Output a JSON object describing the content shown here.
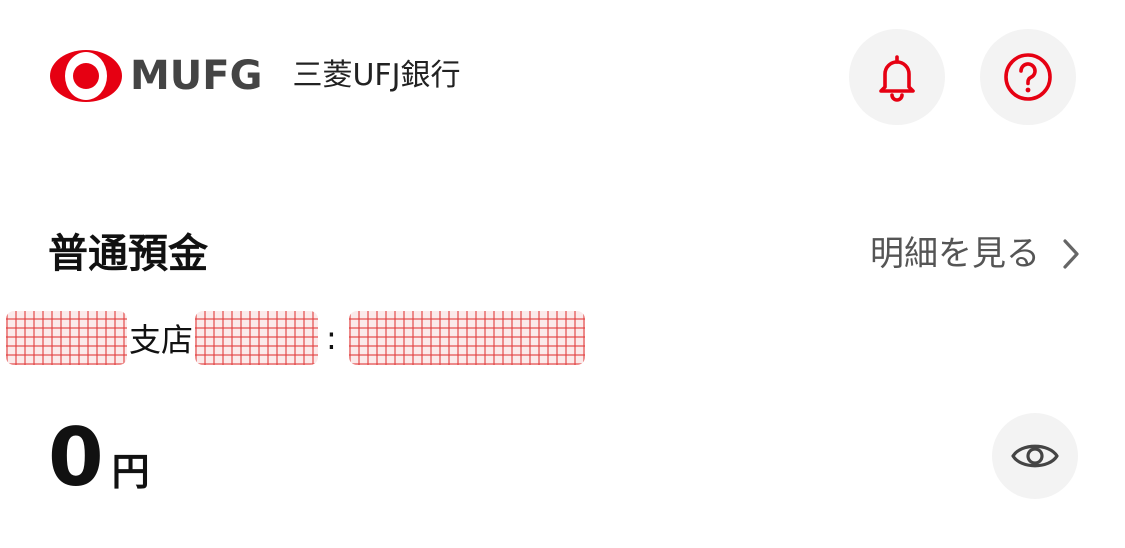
{
  "header": {
    "brand": "MUFG",
    "bank_name": "三菱UFJ銀行",
    "logo_icon": "mufg-logo-icon",
    "notification_icon": "bell-icon",
    "help_icon": "help-question-icon",
    "accent_color": "#e60012"
  },
  "account": {
    "title": "普通預金",
    "details_link": "明細を見る",
    "details_icon": "chevron-right-icon",
    "branch_label": "支店",
    "separator": ":",
    "balance_amount": "0",
    "balance_unit": "円",
    "toggle_visibility_icon": "eye-icon"
  }
}
